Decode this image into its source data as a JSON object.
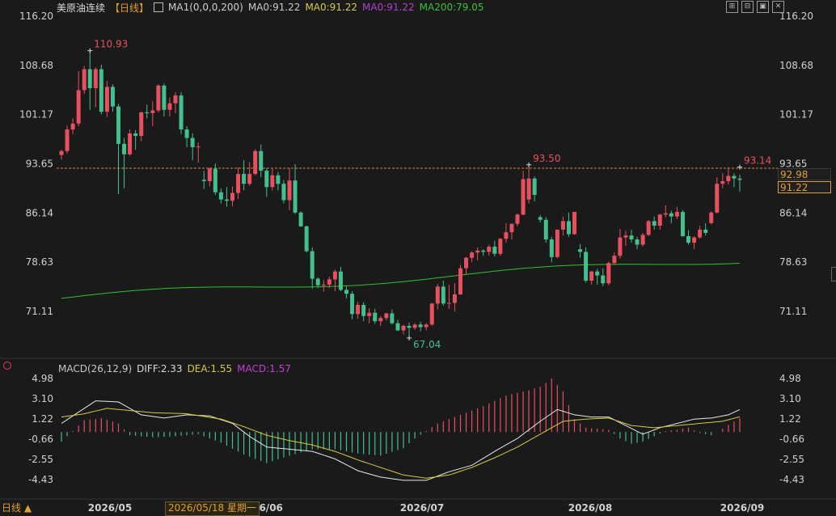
{
  "header": {
    "symbol": "美原油连续",
    "period": "【日线】",
    "ma_icon": "chart-icon",
    "ma_params": "MA1(0,0,0,200)",
    "ma0_label": "MA0:91.22",
    "ma1_value": "MA0:91.22",
    "ma0_value": "MA0:91.22",
    "ma200_value": "MA200:79.05"
  },
  "toolbar": {
    "buttons": [
      "zoom-in-icon",
      "zoom-out-icon",
      "settings-icon",
      "close-icon"
    ]
  },
  "macd_header": {
    "params": "MACD(26,12,9)",
    "diff": "DIFF:2.33",
    "dea": "DEA:1.55",
    "macd": "MACD:1.57"
  },
  "current_price_tag": "92.98",
  "ma_price_tag": "91.22",
  "bottom": {
    "period_label": "日线 ▲",
    "cursor_date": "2026/05/18 星期一"
  },
  "colors": {
    "up": "#e8505f",
    "down": "#42c08e",
    "ma200": "#2fc02f",
    "diff": "#e8e8e8",
    "dea": "#d6cc3a",
    "label_up": "#e8505f",
    "label_down": "#42c08e"
  },
  "chart_data": [
    {
      "type": "candlestick",
      "title": "美原油连续 日线",
      "y_ticks": [
        "116.20",
        "108.68",
        "101.17",
        "93.65",
        "86.14",
        "78.63",
        "71.11"
      ],
      "ylim": [
        67.04,
        116.2
      ],
      "x_ticks": [
        "2026/05",
        "26/06",
        "2026/07",
        "2026/08",
        "2026/09"
      ],
      "annotations": [
        {
          "text": "110.93",
          "value": 110.93,
          "candle": 5
        },
        {
          "text": "93.50",
          "value": 93.5,
          "candle": 82
        },
        {
          "text": "93.14",
          "value": 93.14,
          "candle": 119
        },
        {
          "text": "67.04",
          "value": 67.04,
          "candle": 61
        }
      ],
      "current_price": 92.98,
      "ma200_series": {
        "name": "MA200",
        "start": 73.1,
        "end": 79.05
      },
      "candles": [
        [
          95.0,
          95.8,
          94.3,
          95.6
        ],
        [
          95.6,
          99.5,
          95.2,
          98.9
        ],
        [
          98.9,
          100.6,
          98.2,
          99.8
        ],
        [
          99.8,
          107.8,
          99.4,
          104.9
        ],
        [
          104.9,
          108.6,
          104.3,
          108.1
        ],
        [
          108.1,
          110.9,
          101.9,
          105.2
        ],
        [
          105.2,
          108.4,
          102.3,
          108.1
        ],
        [
          108.1,
          108.8,
          101.2,
          101.6
        ],
        [
          101.6,
          106.3,
          100.8,
          105.4
        ],
        [
          105.4,
          105.8,
          101.6,
          102.4
        ],
        [
          102.4,
          102.8,
          89.0,
          96.7
        ],
        [
          96.7,
          97.6,
          89.9,
          95.1
        ],
        [
          95.1,
          98.9,
          94.9,
          98.3
        ],
        [
          98.3,
          98.8,
          95.8,
          97.9
        ],
        [
          97.9,
          101.6,
          97.1,
          101.5
        ],
        [
          101.5,
          102.7,
          100.6,
          101.4
        ],
        [
          101.4,
          103.2,
          99.4,
          101.8
        ],
        [
          101.8,
          105.8,
          101.5,
          105.6
        ],
        [
          105.6,
          105.9,
          100.9,
          101.9
        ],
        [
          101.9,
          103.8,
          100.9,
          102.9
        ],
        [
          102.9,
          104.6,
          101.4,
          104.1
        ],
        [
          104.1,
          104.6,
          98.2,
          98.9
        ],
        [
          98.9,
          99.4,
          96.2,
          97.6
        ],
        [
          97.6,
          98.3,
          94.2,
          96.2
        ],
        [
          96.2,
          96.9,
          93.8,
          96.3
        ],
        [
          91.2,
          92.6,
          89.8,
          91.0
        ],
        [
          91.0,
          93.1,
          90.2,
          92.9
        ],
        [
          92.9,
          93.7,
          88.9,
          89.3
        ],
        [
          89.3,
          89.9,
          87.6,
          88.2
        ],
        [
          88.2,
          90.1,
          87.1,
          88.0
        ],
        [
          88.0,
          90.2,
          87.2,
          89.2
        ],
        [
          89.2,
          93.1,
          88.3,
          92.1
        ],
        [
          92.1,
          94.2,
          89.6,
          90.6
        ],
        [
          90.6,
          93.9,
          90.3,
          92.1
        ],
        [
          92.1,
          95.9,
          91.9,
          95.6
        ],
        [
          95.6,
          96.6,
          91.6,
          92.6
        ],
        [
          92.6,
          93.0,
          88.6,
          90.1
        ],
        [
          90.1,
          92.9,
          89.6,
          91.9
        ],
        [
          91.9,
          92.4,
          89.6,
          90.6
        ],
        [
          90.6,
          91.2,
          87.6,
          88.1
        ],
        [
          88.1,
          93.0,
          86.6,
          91.1
        ],
        [
          91.1,
          93.6,
          86.0,
          86.2
        ],
        [
          86.2,
          86.4,
          84.0,
          84.1
        ],
        [
          84.1,
          84.2,
          80.1,
          80.3
        ],
        [
          80.3,
          80.9,
          74.6,
          76.1
        ],
        [
          76.1,
          76.3,
          74.7,
          75.1
        ],
        [
          75.1,
          75.9,
          74.1,
          75.2
        ],
        [
          75.2,
          76.4,
          74.7,
          76.0
        ],
        [
          76.0,
          77.5,
          74.2,
          77.2
        ],
        [
          77.2,
          77.9,
          74.2,
          74.4
        ],
        [
          74.4,
          74.9,
          73.1,
          73.8
        ],
        [
          73.8,
          74.2,
          69.9,
          70.7
        ],
        [
          70.7,
          72.6,
          70.0,
          72.1
        ],
        [
          72.1,
          72.5,
          69.6,
          70.4
        ],
        [
          70.4,
          71.6,
          69.3,
          70.9
        ],
        [
          70.9,
          71.5,
          69.2,
          69.6
        ],
        [
          69.6,
          70.4,
          68.9,
          70.1
        ],
        [
          70.1,
          70.9,
          69.7,
          70.8
        ],
        [
          70.8,
          71.4,
          69.1,
          69.3
        ],
        [
          69.3,
          69.8,
          68.1,
          68.2
        ],
        [
          68.2,
          69.1,
          67.6,
          68.9
        ],
        [
          68.9,
          69.4,
          67.04,
          68.6
        ],
        [
          68.6,
          69.3,
          68.3,
          69.1
        ],
        [
          69.1,
          69.5,
          68.1,
          68.7
        ],
        [
          68.7,
          69.3,
          68.2,
          69.1
        ],
        [
          69.1,
          72.4,
          68.9,
          72.3
        ],
        [
          72.3,
          75.3,
          71.4,
          74.9
        ],
        [
          74.9,
          75.8,
          72.0,
          72.3
        ],
        [
          72.3,
          75.2,
          71.5,
          72.4
        ],
        [
          72.4,
          75.4,
          71.1,
          73.7
        ],
        [
          73.7,
          78.2,
          73.6,
          77.7
        ],
        [
          77.7,
          79.4,
          76.8,
          79.3
        ],
        [
          79.3,
          80.3,
          78.6,
          80.1
        ],
        [
          80.1,
          80.9,
          78.9,
          80.4
        ],
        [
          80.4,
          80.6,
          79.6,
          80.2
        ],
        [
          80.2,
          81.3,
          79.6,
          81.0
        ],
        [
          81.0,
          81.9,
          79.5,
          79.9
        ],
        [
          79.9,
          82.3,
          79.6,
          82.2
        ],
        [
          82.2,
          84.6,
          81.6,
          83.2
        ],
        [
          83.2,
          84.1,
          82.1,
          84.5
        ],
        [
          84.5,
          86.1,
          84.1,
          85.9
        ],
        [
          85.9,
          92.6,
          85.8,
          91.3
        ],
        [
          88.2,
          93.5,
          87.6,
          91.4
        ],
        [
          91.4,
          91.7,
          87.9,
          88.9
        ],
        [
          85.5,
          85.8,
          84.7,
          85.1
        ],
        [
          85.1,
          85.5,
          81.6,
          82.1
        ],
        [
          82.1,
          82.5,
          78.6,
          79.4
        ],
        [
          79.4,
          83.6,
          79.2,
          83.6
        ],
        [
          83.6,
          85.6,
          82.7,
          84.9
        ],
        [
          84.9,
          86.2,
          82.5,
          82.9
        ],
        [
          82.9,
          86.3,
          82.8,
          86.3
        ],
        [
          80.6,
          81.4,
          79.3,
          80.2
        ],
        [
          80.2,
          80.9,
          75.5,
          75.8
        ],
        [
          75.8,
          77.3,
          75.2,
          77.2
        ],
        [
          77.2,
          77.6,
          75.2,
          76.6
        ],
        [
          76.6,
          77.7,
          75.0,
          75.4
        ],
        [
          75.4,
          78.7,
          75.1,
          78.5
        ],
        [
          78.5,
          80.1,
          78.2,
          79.6
        ],
        [
          79.6,
          83.7,
          79.2,
          82.4
        ],
        [
          82.4,
          83.4,
          81.1,
          82.7
        ],
        [
          82.7,
          83.6,
          81.6,
          82.1
        ],
        [
          82.1,
          82.5,
          80.6,
          81.3
        ],
        [
          81.3,
          83.1,
          81.0,
          82.8
        ],
        [
          82.8,
          85.1,
          82.6,
          84.9
        ],
        [
          84.9,
          85.6,
          83.6,
          84.2
        ],
        [
          84.2,
          86.0,
          83.6,
          85.9
        ],
        [
          85.9,
          87.3,
          85.5,
          86.1
        ],
        [
          86.1,
          86.5,
          84.6,
          85.6
        ],
        [
          85.6,
          87.1,
          85.2,
          86.3
        ],
        [
          86.3,
          86.6,
          82.5,
          82.6
        ],
        [
          82.6,
          83.5,
          81.3,
          81.6
        ],
        [
          81.6,
          82.6,
          80.6,
          82.4
        ],
        [
          82.4,
          84.2,
          82.2,
          83.6
        ],
        [
          83.6,
          84.6,
          82.7,
          83.1
        ],
        [
          84.6,
          86.4,
          84.4,
          86.2
        ],
        [
          86.2,
          91.6,
          86.1,
          90.6
        ],
        [
          90.6,
          92.2,
          89.9,
          91.0
        ],
        [
          91.0,
          93.14,
          90.5,
          91.8
        ],
        [
          91.8,
          92.2,
          90.1,
          91.4
        ],
        [
          91.4,
          92.0,
          89.4,
          91.2
        ]
      ]
    },
    {
      "type": "macd",
      "title": "MACD(26,12,9)",
      "y_ticks": [
        "4.98",
        "3.10",
        "1.22",
        "-0.66",
        "-2.55",
        "-4.43"
      ],
      "ylim": [
        -4.43,
        4.98
      ],
      "series": [
        {
          "name": "DIFF",
          "keypoints": [
            [
              0,
              0.8
            ],
            [
              4,
              2.2
            ],
            [
              6,
              2.9
            ],
            [
              10,
              2.8
            ],
            [
              14,
              1.6
            ],
            [
              18,
              1.3
            ],
            [
              22,
              1.6
            ],
            [
              26,
              1.5
            ],
            [
              30,
              0.8
            ],
            [
              33,
              -0.4
            ],
            [
              36,
              -1.4
            ],
            [
              40,
              -1.6
            ],
            [
              44,
              -1.8
            ],
            [
              48,
              -2.5
            ],
            [
              52,
              -3.6
            ],
            [
              56,
              -4.2
            ],
            [
              60,
              -4.5
            ],
            [
              64,
              -4.5
            ],
            [
              68,
              -3.7
            ],
            [
              72,
              -3.1
            ],
            [
              76,
              -1.8
            ],
            [
              80,
              -0.6
            ],
            [
              84,
              1.0
            ],
            [
              87,
              2.1
            ],
            [
              90,
              1.6
            ],
            [
              93,
              1.4
            ],
            [
              96,
              1.4
            ],
            [
              99,
              0.6
            ],
            [
              102,
              -0.2
            ],
            [
              105,
              0.4
            ],
            [
              108,
              0.8
            ],
            [
              111,
              1.2
            ],
            [
              114,
              1.3
            ],
            [
              117,
              1.6
            ],
            [
              120,
              2.33
            ]
          ]
        },
        {
          "name": "DEA",
          "keypoints": [
            [
              0,
              1.4
            ],
            [
              4,
              1.7
            ],
            [
              8,
              2.2
            ],
            [
              12,
              2.0
            ],
            [
              16,
              1.8
            ],
            [
              22,
              1.7
            ],
            [
              28,
              1.2
            ],
            [
              32,
              0.5
            ],
            [
              36,
              -0.3
            ],
            [
              40,
              -0.8
            ],
            [
              44,
              -1.2
            ],
            [
              48,
              -1.8
            ],
            [
              52,
              -2.6
            ],
            [
              56,
              -3.3
            ],
            [
              60,
              -4.0
            ],
            [
              64,
              -4.3
            ],
            [
              68,
              -4.0
            ],
            [
              72,
              -3.3
            ],
            [
              76,
              -2.4
            ],
            [
              80,
              -1.4
            ],
            [
              84,
              -0.2
            ],
            [
              88,
              1.0
            ],
            [
              92,
              1.2
            ],
            [
              96,
              1.3
            ],
            [
              100,
              0.6
            ],
            [
              104,
              0.4
            ],
            [
              108,
              0.6
            ],
            [
              112,
              0.8
            ],
            [
              116,
              1.0
            ],
            [
              120,
              1.55
            ]
          ]
        }
      ],
      "hist_keypoints": [
        [
          0,
          -0.9
        ],
        [
          4,
          1.1
        ],
        [
          7,
          1.3
        ],
        [
          10,
          0.8
        ],
        [
          12,
          -0.3
        ],
        [
          16,
          -0.5
        ],
        [
          20,
          -0.4
        ],
        [
          24,
          -0.2
        ],
        [
          28,
          -1.0
        ],
        [
          32,
          -2.1
        ],
        [
          36,
          -2.9
        ],
        [
          40,
          -2.2
        ],
        [
          44,
          -1.6
        ],
        [
          48,
          -1.6
        ],
        [
          52,
          -2.0
        ],
        [
          56,
          -2.2
        ],
        [
          60,
          -1.5
        ],
        [
          62,
          -0.6
        ],
        [
          64,
          0.1
        ],
        [
          66,
          0.8
        ],
        [
          70,
          1.6
        ],
        [
          74,
          2.4
        ],
        [
          78,
          3.4
        ],
        [
          82,
          3.9
        ],
        [
          84,
          4.2
        ],
        [
          86,
          4.98
        ],
        [
          88,
          3.8
        ],
        [
          90,
          1.2
        ],
        [
          92,
          0.4
        ],
        [
          94,
          0.3
        ],
        [
          96,
          0.2
        ],
        [
          98,
          -0.6
        ],
        [
          100,
          -1.1
        ],
        [
          102,
          -0.9
        ],
        [
          104,
          -0.4
        ],
        [
          106,
          0.1
        ],
        [
          108,
          0.2
        ],
        [
          110,
          0.4
        ],
        [
          112,
          -0.1
        ],
        [
          114,
          -0.3
        ],
        [
          116,
          0.3
        ],
        [
          118,
          1.0
        ],
        [
          120,
          1.57
        ]
      ]
    }
  ]
}
